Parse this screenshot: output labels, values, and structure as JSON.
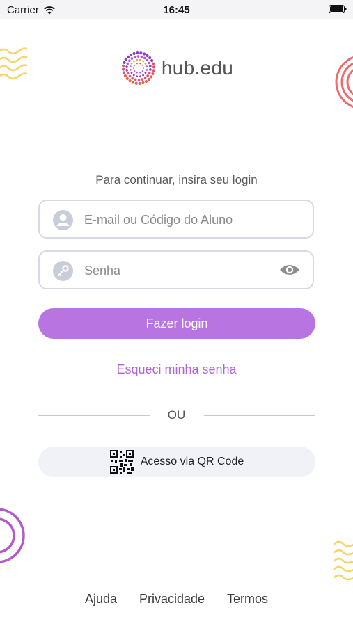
{
  "status_bar": {
    "carrier": "Carrier",
    "time": "16:45",
    "wifi_icon": "wifi-icon",
    "battery_icon": "battery-icon"
  },
  "brand": {
    "name": "hub.edu",
    "logo_icon": "dotted-sunburst-logo"
  },
  "login": {
    "prompt": "Para continuar, insira seu login",
    "email_placeholder": "E-mail ou Código do Aluno",
    "email_value": "",
    "password_placeholder": "Senha",
    "password_value": "",
    "submit_label": "Fazer login",
    "forgot_label": "Esqueci minha senha",
    "separator": "OU",
    "qr_label": "Acesso via QR Code"
  },
  "footer": {
    "help": "Ajuda",
    "privacy": "Privacidade",
    "terms": "Termos"
  },
  "colors": {
    "accent": "#b874e0",
    "link": "#ad66d8",
    "field_border": "#d7dae6",
    "deco_yellow": "#f6d36b",
    "deco_red": "#ef6a6a",
    "deco_purple": "#b458cc"
  }
}
